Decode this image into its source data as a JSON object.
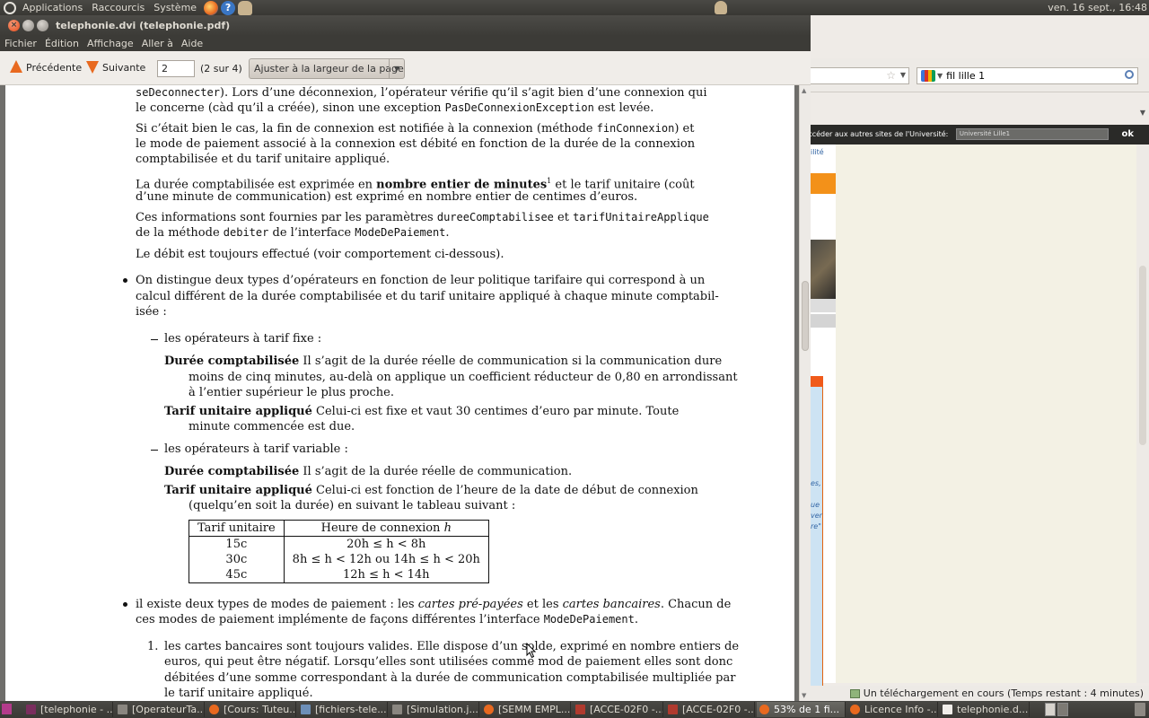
{
  "top_panel": {
    "menus": [
      "Applications",
      "Raccourcis",
      "Système"
    ],
    "clock": "ven. 16 sept., 16:48"
  },
  "firefox": {
    "search_value": "fil lille 1",
    "site_strip_label": "Accéder aux autres sites de l'Université:",
    "site_select": "Université Lille1",
    "site_ok": "ok",
    "left_link": "ilité",
    "left_fragments": [
      "es,",
      "ue",
      "ver",
      "re\""
    ],
    "status": "Un téléchargement en cours (Temps restant : 4 minutes)"
  },
  "evince": {
    "window_title": "telephonie.dvi (telephonie.pdf)",
    "menus": [
      "Fichier",
      "Édition",
      "Affichage",
      "Aller à",
      "Aide"
    ],
    "toolbar": {
      "prev_label": "Précédente",
      "next_label": "Suivante",
      "page_value": "2",
      "page_count": "(2 sur 4)",
      "zoom_label": "Ajuster à la largeur de la page"
    }
  },
  "document": {
    "l1a": "seDeconnecter",
    "l1b": "). Lors d’une déconnexion, l’opérateur vérifie qu’il s’agit bien d’une connexion qui",
    "l2a": "le concerne (càd qu’il a créée), sinon une exception ",
    "l2b": "PasDeConnexionException",
    "l2c": " est levée.",
    "l3a": "Si c’était bien le cas, la fin de connexion est notifiée à la connexion (méthode ",
    "l3b": "finConnexion",
    "l3c": ") et",
    "l4": "le mode de paiement associé à la connexion est débité en fonction de la durée de la connexion",
    "l5": "comptabilisée et du tarif unitaire appliqué.",
    "l6a": "La durée comptabilisée est exprimée en ",
    "l6b": "nombre entier de minutes",
    "l6sup": "1",
    "l6c": " et le tarif unitaire (coût",
    "l7": "d’une minute de communication) est exprimé en nombre entier de centimes d’euros.",
    "l8a": "Ces informations sont fournies par les paramètres ",
    "l8b": "dureeComptabilisee",
    "l8c": " et ",
    "l8d": "tarifUnitaireApplique",
    "l9a": "de la méthode ",
    "l9b": "debiter",
    "l9c": " de l’interface ",
    "l9d": "ModeDePaiement",
    "l9e": ".",
    "l10": "Le débit est toujours effectué (voir comportement ci-dessous).",
    "b1l1": "On distingue deux types d’opérateurs en fonction de leur politique tarifaire qui correspond à un",
    "b1l2": "calcul différent de la durée comptabilisée et du tarif unitaire appliqué à chaque minute comptabil-",
    "b1l3": "isée :",
    "d1": "les opérateurs à tarif fixe :",
    "f1a": "Durée comptabilisée",
    "f1b": " Il s’agit de la durée réelle de communication si la communication dure",
    "f1c": "moins de cinq minutes, au-delà on applique un coefficient réducteur de 0,80 en arrondissant",
    "f1d": "à l’entier supérieur le plus proche.",
    "f2a": "Tarif unitaire appliqué",
    "f2b": " Celui-ci est fixe et vaut 30 centimes d’euro par minute.  Toute",
    "f2c": "minute commencée est due.",
    "d2": "les opérateurs à tarif variable :",
    "v1a": "Durée comptabilisée",
    "v1b": " Il s’agit de la durée réelle de communication.",
    "v2a": "Tarif unitaire appliqué",
    "v2b": " Celui-ci est fonction de l’heure de la date de début de connexion",
    "v2c": "(quelqu’en soit la durée) en suivant le tableau suivant :",
    "table_headers": [
      "Tarif unitaire",
      "Heure de connexion h"
    ],
    "table_rows": [
      [
        "15c",
        "20h ≤ h < 8h"
      ],
      [
        "30c",
        "8h ≤ h < 12h ou 14h ≤ h < 20h"
      ],
      [
        "45c",
        "12h ≤ h < 14h"
      ]
    ],
    "b2a": "il existe deux types de modes de paiement : les ",
    "b2b": "cartes pré-payées",
    "b2c": " et les ",
    "b2d": "cartes bancaires",
    "b2e": ". Chacun de",
    "b2f": "ces modes de paiement implémente de façons différentes l’interface ",
    "b2g": "ModeDePaiement",
    "b2h": ".",
    "n1num": "1.",
    "n1a": "les cartes bancaires sont toujours valides.  Elle dispose d’un solde, exprimé en nombre entiers de",
    "n1b": "euros, qui peut être négatif.  Lorsqu’elles sont utilisées comme mod de paiement elles sont donc",
    "n1c": "débitées d’une somme correspondant à la durée de communication comptabilisée multipliée par",
    "n1d": "le tarif unitaire appliqué."
  },
  "taskbar": {
    "tasks": [
      {
        "label": "[telephonie - ...",
        "icon_color": "#7a2e5e"
      },
      {
        "label": "[OperateurTa...",
        "icon_color": "#8a8680"
      },
      {
        "label": "[Cours: Tuteu...",
        "icon_color": "#e8691f"
      },
      {
        "label": "[fichiers-tele...",
        "icon_color": "#6d8fb8"
      },
      {
        "label": "[Simulation.j...",
        "icon_color": "#8a8680"
      },
      {
        "label": "[SEMM EMPL...",
        "icon_color": "#e8691f"
      },
      {
        "label": "[ACCE-02F0 -...",
        "icon_color": "#b03a2e"
      },
      {
        "label": "[ACCE-02F0 -...",
        "icon_color": "#b03a2e"
      },
      {
        "label": "53% de 1 fi...",
        "icon_color": "#e8691f"
      },
      {
        "label": "Licence Info -...",
        "icon_color": "#e8691f"
      },
      {
        "label": "telephonie.d...",
        "icon_color": "#f0ede9"
      }
    ]
  }
}
